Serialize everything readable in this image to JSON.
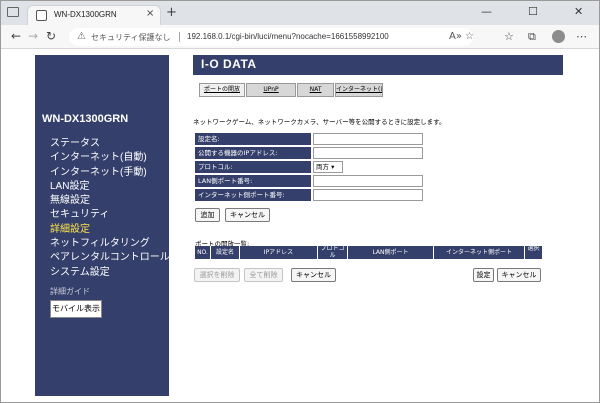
{
  "browser": {
    "tab_title": "WN-DX1300GRN",
    "tab_close": "×",
    "new_tab": "+",
    "controls": {
      "minimize": "—",
      "maximize": "☐",
      "close": "✕"
    },
    "nav": {
      "back": "←",
      "forward": "→",
      "reload": "↻"
    },
    "security_icon": "⚠",
    "security_text": "セキュリティ保護なし",
    "url": "192.168.0.1/cgi-bin/luci/menu?nocache=1661558992100",
    "omnibox_icons": {
      "read_aloud": "A»",
      "favorite": "☆"
    },
    "toolbar_icons": {
      "favorites": "☆",
      "collections": "⧉",
      "more": "⋯"
    }
  },
  "sidebar": {
    "model": "WN-DX1300GRN",
    "items": [
      {
        "label": "ステータス",
        "active": false
      },
      {
        "label": "インターネット(自動)",
        "active": false
      },
      {
        "label": "インターネット(手動)",
        "active": false
      },
      {
        "label": "LAN設定",
        "active": false
      },
      {
        "label": "無線設定",
        "active": false
      },
      {
        "label": "セキュリティ",
        "active": false
      },
      {
        "label": "詳細設定",
        "active": true
      },
      {
        "label": "ネットフィルタリング",
        "active": false
      },
      {
        "label": "ペアレンタルコントロール",
        "active": false
      },
      {
        "label": "システム設定",
        "active": false
      }
    ],
    "guide": "詳細ガイド",
    "mobile_button": "モバイル表示"
  },
  "banner": {
    "logo": "I-O DATA"
  },
  "subtabs": [
    {
      "label": "ポートの開放",
      "selected": true
    },
    {
      "label": "UPnP",
      "selected": false
    },
    {
      "label": "NAT",
      "selected": false
    },
    {
      "label": "インターネット(自動)",
      "selected": false
    }
  ],
  "intro": "ネットワークゲーム、ネットワークカメラ、サーバー等を公開するときに設定します。",
  "form": {
    "fields": [
      {
        "label": "設定名:",
        "value": ""
      },
      {
        "label": "公開する機器のIPアドレス:",
        "value": ""
      },
      {
        "label": "プロトコル:",
        "value": "両方 ▾"
      },
      {
        "label": "LAN側ポート番号:",
        "value": ""
      },
      {
        "label": "インターネット側ポート番号:",
        "value": ""
      }
    ],
    "add_button": "追加",
    "cancel_button": "キャンセル"
  },
  "list": {
    "title": "ポートの開放一覧:",
    "columns": [
      "NO.",
      "設定名",
      "IPアドレス",
      "プロトコル",
      "LAN側ポート",
      "インターネット側ポート",
      "選択"
    ],
    "delete_selected": "選択を削除",
    "delete_all": "全て削除",
    "cancel": "キャンセル",
    "apply": "設定",
    "cancel2": "キャンセル"
  }
}
